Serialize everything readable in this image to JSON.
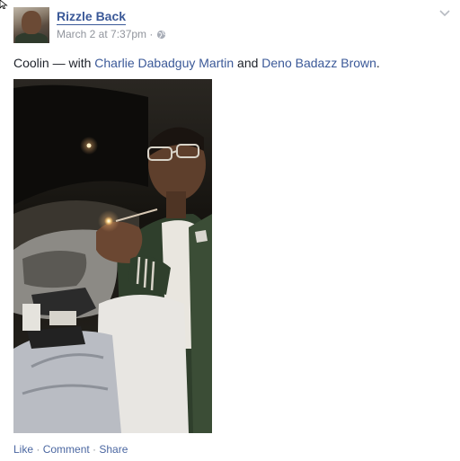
{
  "post": {
    "author": "Rizzle Back",
    "date": "March 2 at 7:37pm",
    "meta_separator": "·",
    "privacy_icon": "globe-icon",
    "menu_icon": "chevron-down-icon",
    "caption": {
      "text": "Coolin",
      "with_prefix": " — with ",
      "tag1": "Charlie Dabadguy Martin",
      "and": " and ",
      "tag2": "Deno Badazz Brown",
      "end": "."
    },
    "photo": {
      "description_icon": "photo"
    },
    "actions": {
      "like": "Like",
      "comment": "Comment",
      "share": "Share",
      "separator": " · "
    }
  },
  "colors": {
    "link": "#3b5998",
    "meta": "#90949c",
    "text": "#1d2129"
  }
}
